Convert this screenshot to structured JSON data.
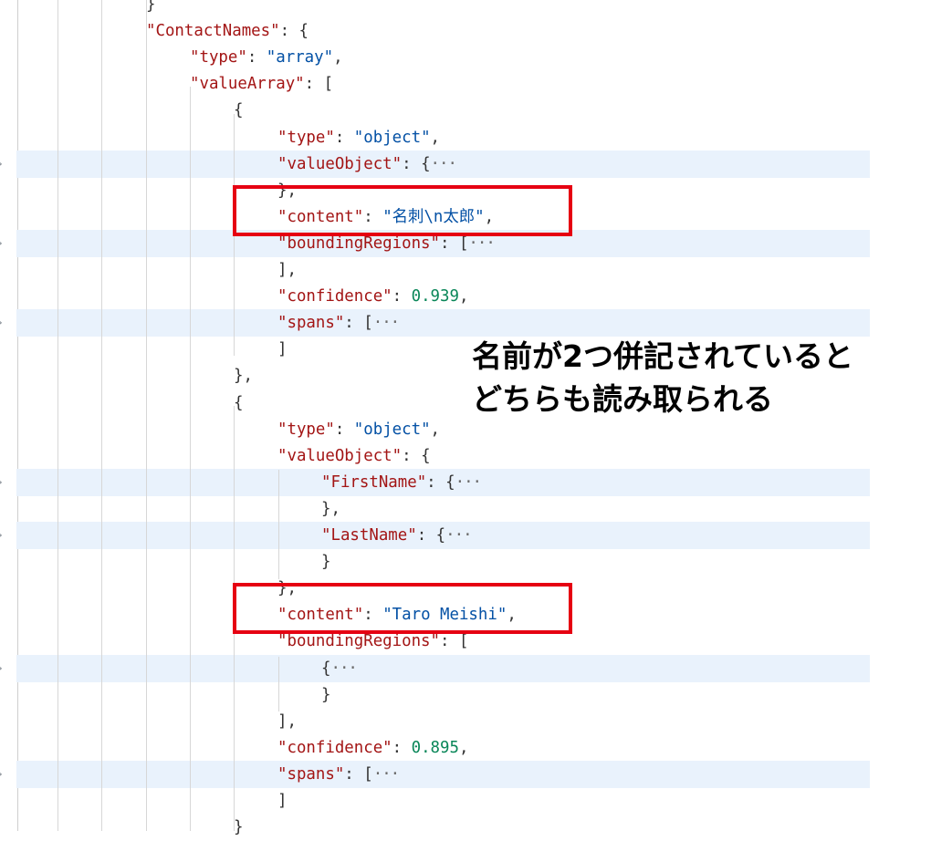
{
  "editor": {
    "lines": [
      {
        "indent": 0,
        "tokens": [
          {
            "t": "p",
            "v": "}"
          }
        ]
      },
      {
        "indent": 0,
        "tokens": [
          {
            "t": "k",
            "v": "\"ContactNames\""
          },
          {
            "t": "p",
            "v": ": {"
          }
        ]
      },
      {
        "indent": 1,
        "tokens": [
          {
            "t": "k",
            "v": "\"type\""
          },
          {
            "t": "p",
            "v": ": "
          },
          {
            "t": "s",
            "v": "\"array\""
          },
          {
            "t": "p",
            "v": ","
          }
        ]
      },
      {
        "indent": 1,
        "tokens": [
          {
            "t": "k",
            "v": "\"valueArray\""
          },
          {
            "t": "p",
            "v": ": ["
          }
        ]
      },
      {
        "indent": 2,
        "tokens": [
          {
            "t": "p",
            "v": "{"
          }
        ]
      },
      {
        "indent": 3,
        "tokens": [
          {
            "t": "k",
            "v": "\"type\""
          },
          {
            "t": "p",
            "v": ": "
          },
          {
            "t": "s",
            "v": "\"object\""
          },
          {
            "t": "p",
            "v": ","
          }
        ]
      },
      {
        "indent": 3,
        "folded": true,
        "tokens": [
          {
            "t": "k",
            "v": "\"valueObject\""
          },
          {
            "t": "p",
            "v": ": {"
          },
          {
            "t": "ell",
            "v": "···"
          }
        ]
      },
      {
        "indent": 3,
        "tokens": [
          {
            "t": "p",
            "v": "},"
          }
        ]
      },
      {
        "indent": 3,
        "tokens": [
          {
            "t": "k",
            "v": "\"content\""
          },
          {
            "t": "p",
            "v": ": "
          },
          {
            "t": "s",
            "v": "\"名刺\\n太郎\""
          },
          {
            "t": "p",
            "v": ","
          }
        ]
      },
      {
        "indent": 3,
        "folded": true,
        "tokens": [
          {
            "t": "k",
            "v": "\"boundingRegions\""
          },
          {
            "t": "p",
            "v": ": ["
          },
          {
            "t": "ell",
            "v": "···"
          }
        ]
      },
      {
        "indent": 3,
        "tokens": [
          {
            "t": "p",
            "v": "],"
          }
        ]
      },
      {
        "indent": 3,
        "tokens": [
          {
            "t": "k",
            "v": "\"confidence\""
          },
          {
            "t": "p",
            "v": ": "
          },
          {
            "t": "n",
            "v": "0.939"
          },
          {
            "t": "p",
            "v": ","
          }
        ]
      },
      {
        "indent": 3,
        "folded": true,
        "tokens": [
          {
            "t": "k",
            "v": "\"spans\""
          },
          {
            "t": "p",
            "v": ": ["
          },
          {
            "t": "ell",
            "v": "···"
          }
        ]
      },
      {
        "indent": 3,
        "tokens": [
          {
            "t": "p",
            "v": "]"
          }
        ]
      },
      {
        "indent": 2,
        "tokens": [
          {
            "t": "p",
            "v": "},"
          }
        ]
      },
      {
        "indent": 2,
        "tokens": [
          {
            "t": "p",
            "v": "{"
          }
        ]
      },
      {
        "indent": 3,
        "tokens": [
          {
            "t": "k",
            "v": "\"type\""
          },
          {
            "t": "p",
            "v": ": "
          },
          {
            "t": "s",
            "v": "\"object\""
          },
          {
            "t": "p",
            "v": ","
          }
        ]
      },
      {
        "indent": 3,
        "tokens": [
          {
            "t": "k",
            "v": "\"valueObject\""
          },
          {
            "t": "p",
            "v": ": {"
          }
        ]
      },
      {
        "indent": 4,
        "folded": true,
        "tokens": [
          {
            "t": "k",
            "v": "\"FirstName\""
          },
          {
            "t": "p",
            "v": ": {"
          },
          {
            "t": "ell",
            "v": "···"
          }
        ]
      },
      {
        "indent": 4,
        "tokens": [
          {
            "t": "p",
            "v": "},"
          }
        ]
      },
      {
        "indent": 4,
        "folded": true,
        "tokens": [
          {
            "t": "k",
            "v": "\"LastName\""
          },
          {
            "t": "p",
            "v": ": {"
          },
          {
            "t": "ell",
            "v": "···"
          }
        ]
      },
      {
        "indent": 4,
        "tokens": [
          {
            "t": "p",
            "v": "}"
          }
        ]
      },
      {
        "indent": 3,
        "tokens": [
          {
            "t": "p",
            "v": "},"
          }
        ]
      },
      {
        "indent": 3,
        "tokens": [
          {
            "t": "k",
            "v": "\"content\""
          },
          {
            "t": "p",
            "v": ": "
          },
          {
            "t": "s",
            "v": "\"Taro Meishi\""
          },
          {
            "t": "p",
            "v": ","
          }
        ]
      },
      {
        "indent": 3,
        "tokens": [
          {
            "t": "k",
            "v": "\"boundingRegions\""
          },
          {
            "t": "p",
            "v": ": ["
          }
        ]
      },
      {
        "indent": 4,
        "folded": true,
        "tokens": [
          {
            "t": "p",
            "v": "{"
          },
          {
            "t": "ell",
            "v": "···"
          }
        ]
      },
      {
        "indent": 4,
        "tokens": [
          {
            "t": "p",
            "v": "}"
          }
        ]
      },
      {
        "indent": 3,
        "tokens": [
          {
            "t": "p",
            "v": "],"
          }
        ]
      },
      {
        "indent": 3,
        "tokens": [
          {
            "t": "k",
            "v": "\"confidence\""
          },
          {
            "t": "p",
            "v": ": "
          },
          {
            "t": "n",
            "v": "0.895"
          },
          {
            "t": "p",
            "v": ","
          }
        ]
      },
      {
        "indent": 3,
        "folded": true,
        "tokens": [
          {
            "t": "k",
            "v": "\"spans\""
          },
          {
            "t": "p",
            "v": ": ["
          },
          {
            "t": "ell",
            "v": "···"
          }
        ]
      },
      {
        "indent": 3,
        "tokens": [
          {
            "t": "p",
            "v": "]"
          }
        ]
      },
      {
        "indent": 2,
        "tokens": [
          {
            "t": "p",
            "v": "}"
          }
        ]
      }
    ]
  },
  "annotation": {
    "line1": "名前が2つ併記されていると",
    "line2": "どちらも読み取られる",
    "box_color": "#e60012"
  },
  "colors": {
    "key": "#a31515",
    "string": "#0451a5",
    "number": "#098658",
    "fold_highlight": "#e9f2fc"
  },
  "icons": [
    "fold-chevron-icon"
  ]
}
